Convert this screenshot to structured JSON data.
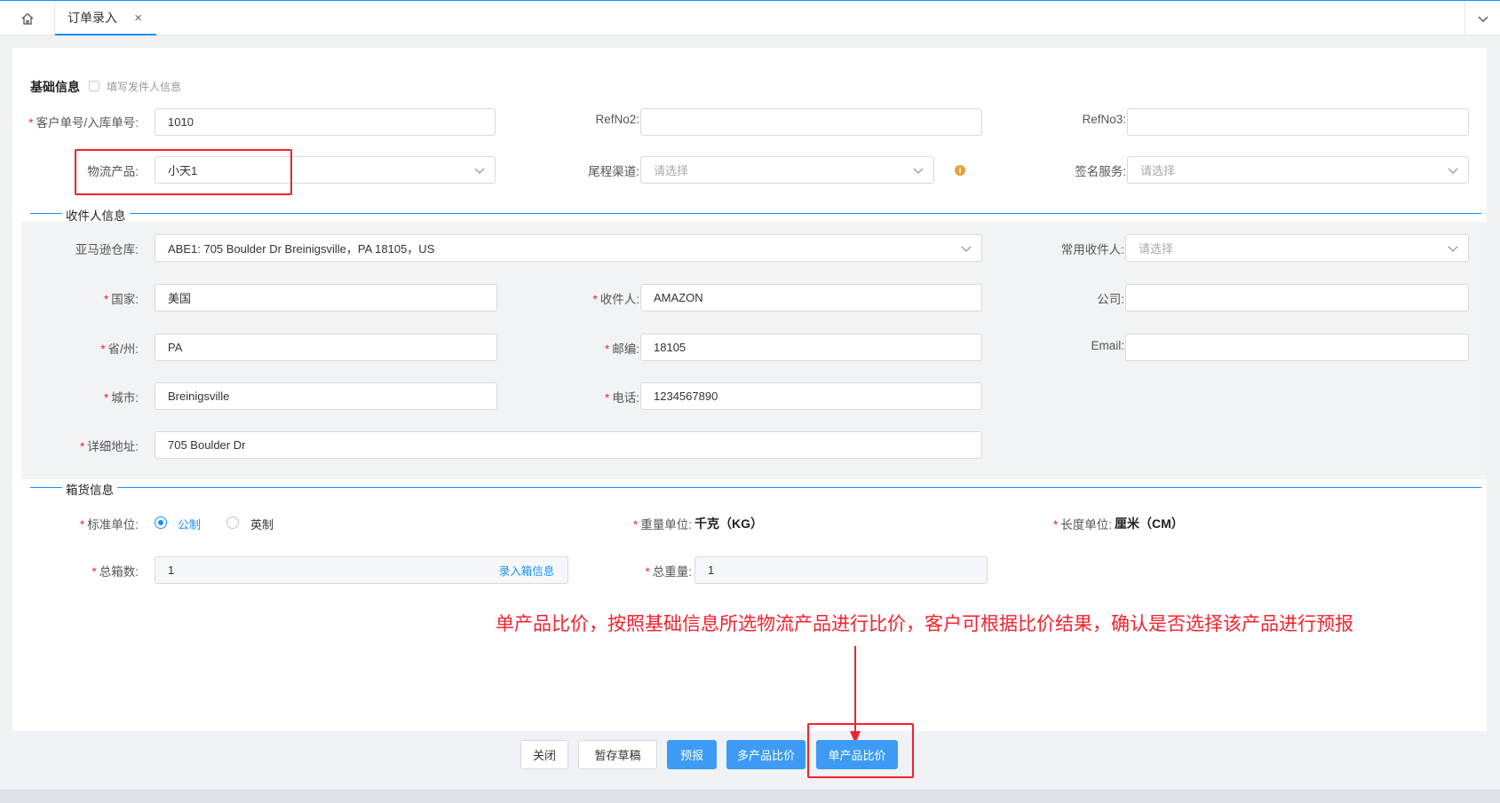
{
  "tabs": {
    "home_icon": "home-icon",
    "active_label": "订单录入",
    "close_glyph": "×",
    "menu_icon": "chevron-down-icon"
  },
  "basic": {
    "title": "基础信息",
    "sender_checkbox_label": "填写发件人信息",
    "customer_no_label": "客户单号/入库单号:",
    "customer_no_value": "1010",
    "refno2_label": "RefNo2:",
    "refno2_value": "",
    "refno3_label": "RefNo3:",
    "refno3_value": "",
    "logistics_label": "物流产品:",
    "logistics_value": "小天1",
    "tail_channel_label": "尾程渠道:",
    "tail_channel_placeholder": "请选择",
    "sign_service_label": "签名服务:",
    "sign_service_placeholder": "请选择"
  },
  "receiver": {
    "title": "收件人信息",
    "amazon_label": "亚马逊仓库:",
    "amazon_value": "ABE1:  705 Boulder Dr Breinigsville，PA 18105，US",
    "common_label": "常用收件人:",
    "common_placeholder": "请选择",
    "country_label": "国家:",
    "country_value": "美国",
    "name_label": "收件人:",
    "name_value": "AMAZON",
    "company_label": "公司:",
    "company_value": "",
    "state_label": "省/州:",
    "state_value": "PA",
    "zip_label": "邮编:",
    "zip_value": "18105",
    "email_label": "Email:",
    "email_value": "",
    "city_label": "城市:",
    "city_value": "Breinigsville",
    "phone_label": "电话:",
    "phone_value": "1234567890",
    "address_label": "详细地址:",
    "address_value": "705 Boulder Dr"
  },
  "box": {
    "title": "箱货信息",
    "unit_label": "标准单位:",
    "unit_metric": "公制",
    "unit_imperial": "英制",
    "weight_unit_label": "重量单位:",
    "weight_unit_value": "千克（KG）",
    "length_unit_label": "长度单位:",
    "length_unit_value": "厘米（CM）",
    "total_boxes_label": "总箱数:",
    "total_boxes_value": "1",
    "enter_box_btn": "录入箱信息",
    "total_weight_label": "总重量:",
    "total_weight_value": "1"
  },
  "annotation": "单产品比价，按照基础信息所选物流产品进行比价，客户可根据比价结果，确认是否选择该产品进行预报",
  "footer": {
    "close": "关闭",
    "draft": "暂存草稿",
    "forecast": "预报",
    "multi_compare": "多产品比价",
    "single_compare": "单产品比价"
  },
  "colors": {
    "primary": "#1890ff",
    "annotation_red": "#f5222d",
    "warning": "#e6a23c"
  }
}
